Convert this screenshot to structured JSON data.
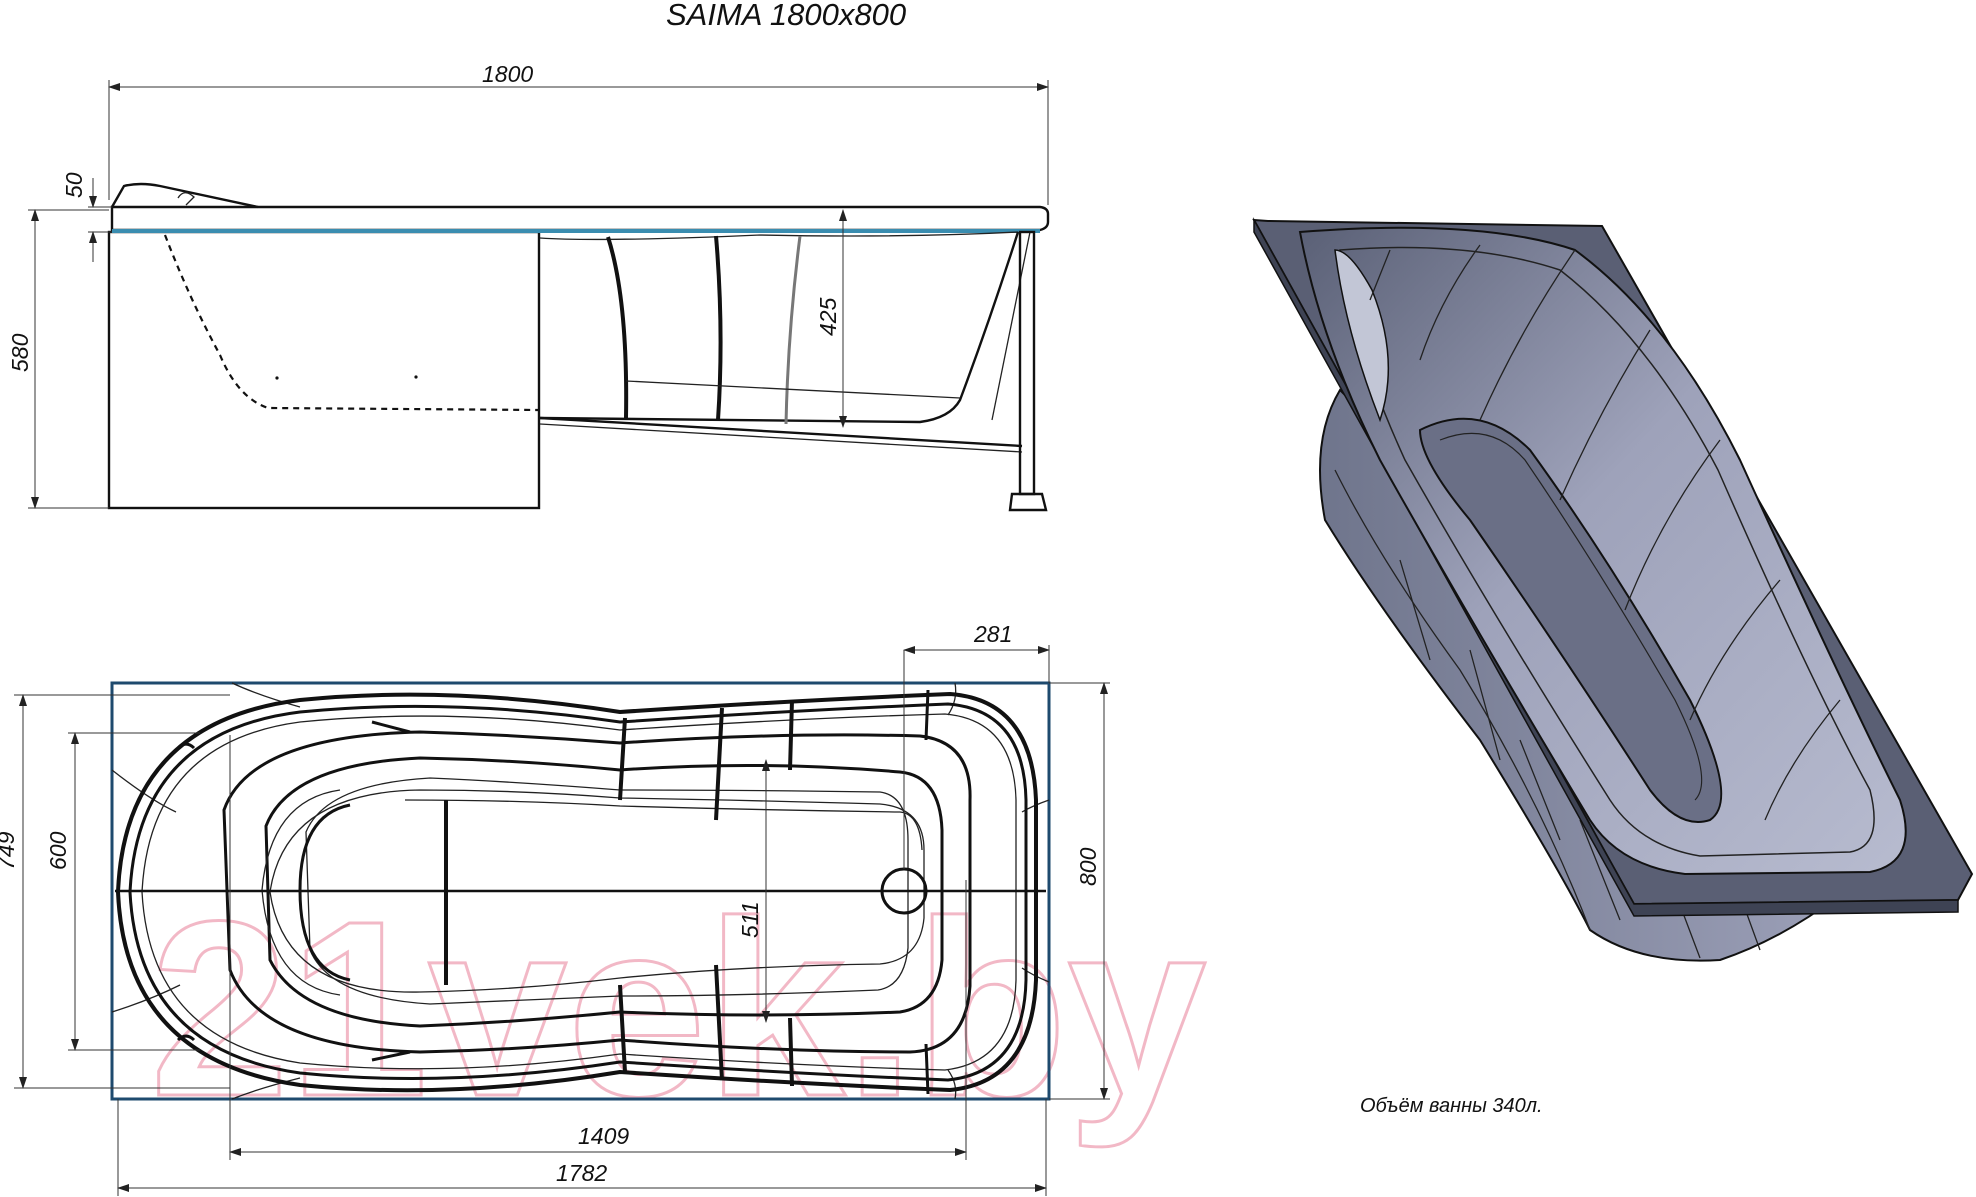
{
  "title": "SAIMA 1800x800",
  "side_view": {
    "dims": {
      "length": "1800",
      "rim": "50",
      "height": "580",
      "depth": "425"
    }
  },
  "top_view": {
    "dims": {
      "drain_offset": "281",
      "inner_width": "749",
      "head_width": "600",
      "floor_width": "511",
      "outer_width": "800",
      "floor_length": "1409",
      "inner_length": "1782"
    }
  },
  "iso_view": {
    "label": "bathtub-3d-render"
  },
  "volume_note": "Объём ванны 340л.",
  "watermark": "21vek.by",
  "colors": {
    "rim_blue": "#3a8db0",
    "frame_blue": "#1e4a6e",
    "tub_body": "#868ba4",
    "tub_dark": "#4e5468",
    "tub_light": "#b9bdd0"
  }
}
